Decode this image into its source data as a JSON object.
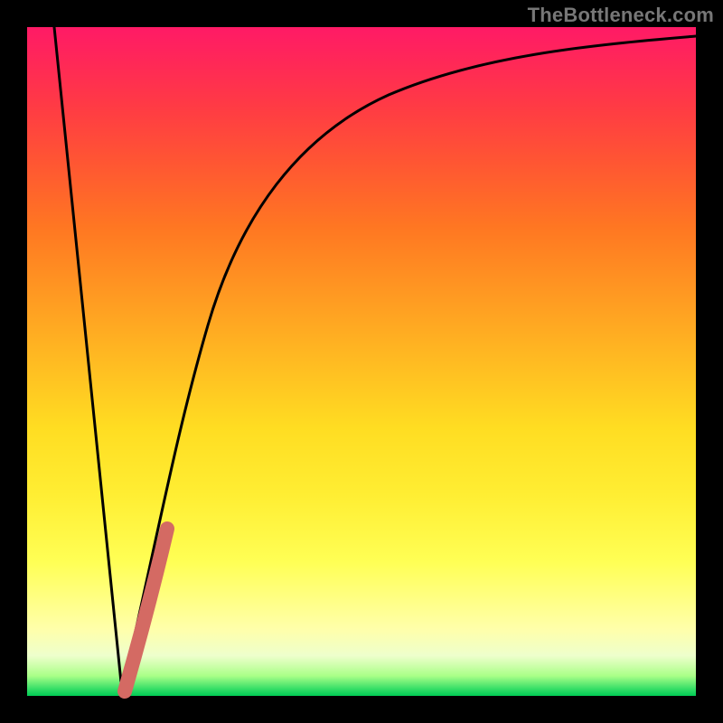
{
  "watermark": "TheBottleneck.com",
  "chart_data": {
    "type": "line",
    "title": "",
    "xlabel": "",
    "ylabel": "",
    "xlim": [
      0,
      100
    ],
    "ylim": [
      0,
      100
    ],
    "grid": false,
    "legend": false,
    "series": [
      {
        "name": "falling-black",
        "x": [
          4,
          14
        ],
        "y": [
          100,
          0
        ],
        "color": "#000000",
        "style": "line"
      },
      {
        "name": "rising-black",
        "x": [
          14,
          18,
          22,
          27,
          35,
          45,
          60,
          80,
          100
        ],
        "y": [
          0,
          20,
          40,
          60,
          80,
          88,
          93,
          96,
          98
        ],
        "color": "#000000",
        "style": "curve"
      },
      {
        "name": "highlight-segment",
        "x": [
          14,
          16,
          18,
          21
        ],
        "y": [
          0,
          8,
          15,
          25
        ],
        "color": "#d46a63",
        "style": "thick-curve"
      }
    ],
    "background_gradient": {
      "direction": "vertical",
      "stops": [
        {
          "pos": 0.0,
          "color": "#ff1a66"
        },
        {
          "pos": 0.2,
          "color": "#ff5533"
        },
        {
          "pos": 0.5,
          "color": "#ffbb22"
        },
        {
          "pos": 0.8,
          "color": "#ffff55"
        },
        {
          "pos": 0.94,
          "color": "#eeffcc"
        },
        {
          "pos": 1.0,
          "color": "#00cc55"
        }
      ]
    }
  }
}
